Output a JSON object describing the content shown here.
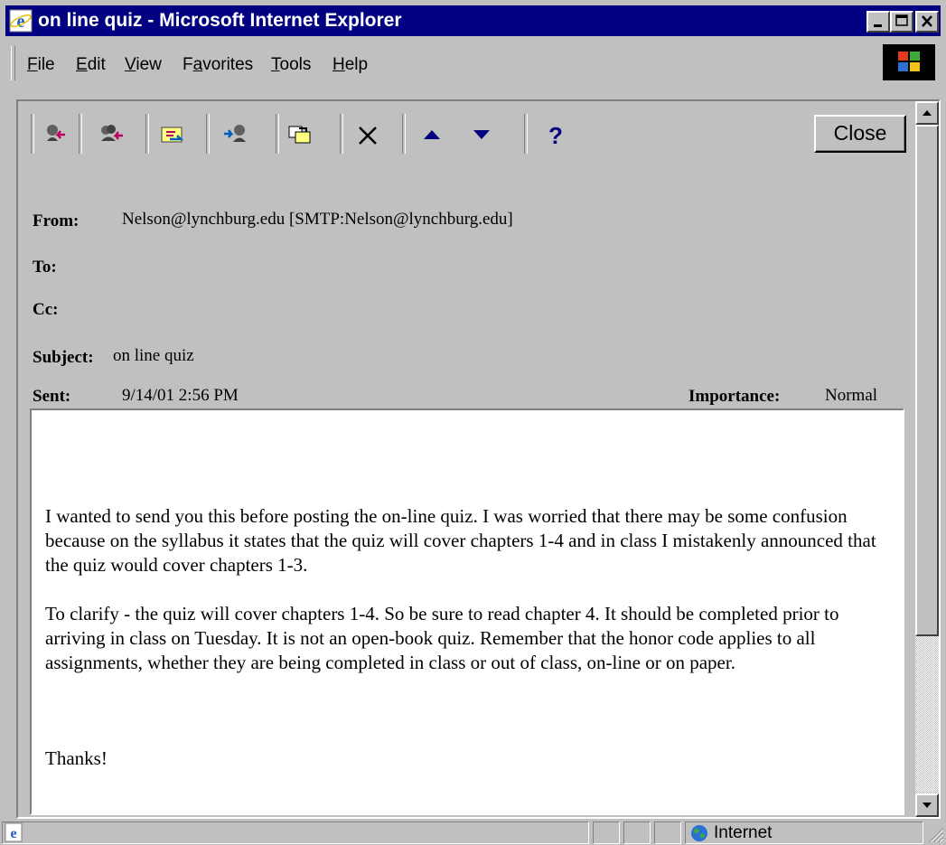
{
  "window": {
    "title": "on line quiz - Microsoft Internet Explorer",
    "icon": "ie-icon",
    "controls": [
      "minimize-icon",
      "maximize-icon",
      "close-icon"
    ]
  },
  "menu": {
    "items": [
      {
        "label": "File",
        "accel": "F",
        "rest": "ile"
      },
      {
        "label": "Edit",
        "accel": "E",
        "rest": "dit"
      },
      {
        "label": "View",
        "accel": "V",
        "rest": "iew"
      },
      {
        "label": "Favorites",
        "pre": "F",
        "accel": "a",
        "rest": "vorites"
      },
      {
        "label": "Tools",
        "accel": "T",
        "rest": "ools"
      },
      {
        "label": "Help",
        "accel": "H",
        "rest": "elp"
      }
    ]
  },
  "toolbar": {
    "icons": [
      "reply-icon",
      "reply-all-icon",
      "forward-icon",
      "forward-alt-icon",
      "move-to-folder-icon",
      "delete-icon",
      "previous-item-icon",
      "next-item-icon",
      "help-icon"
    ],
    "close_label": "Close"
  },
  "message": {
    "from_label": "From:",
    "from_value": "Nelson@lynchburg.edu [SMTP:Nelson@lynchburg.edu]",
    "to_label": "To:",
    "cc_label": "Cc:",
    "subject_label": "Subject:",
    "subject_value": "on line quiz",
    "sent_label": "Sent:",
    "sent_value": "9/14/01 2:56 PM",
    "importance_label": "Importance:",
    "importance_value": "Normal",
    "body": {
      "p1": "I wanted to send you this before posting the on-line quiz.  I was worried that there may be some confusion because on the syllabus it states that the quiz will cover chapters 1-4 and in class I mistakenly announced that the quiz would cover chapters 1-3.",
      "p2": "To clarify - the quiz will cover chapters 1-4.  So be sure to read chapter 4.  It should be completed prior to arriving in class on Tuesday.  It is not an open-book quiz.  Remember that the honor code applies to all assignments, whether they are being completed in class or out of class, on-line or on paper.",
      "p3": "Thanks!"
    }
  },
  "status": {
    "zone_label": "Internet",
    "zone_icon": "globe-icon",
    "page_icon": "ie-page-icon"
  },
  "colors": {
    "titlebar": "#000080",
    "chrome": "#c0c0c0",
    "body_bg": "#ffffff"
  }
}
